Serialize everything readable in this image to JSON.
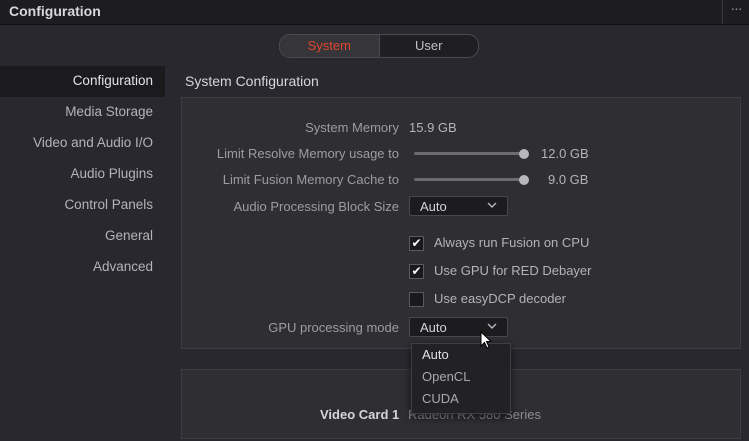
{
  "window": {
    "title": "Configuration",
    "more_glyph": "···"
  },
  "tabs": {
    "system": "System",
    "user": "User"
  },
  "sidebar": {
    "items": [
      {
        "label": "Configuration"
      },
      {
        "label": "Media Storage"
      },
      {
        "label": "Video and Audio I/O"
      },
      {
        "label": "Audio Plugins"
      },
      {
        "label": "Control Panels"
      },
      {
        "label": "General"
      },
      {
        "label": "Advanced"
      }
    ],
    "active": "Configuration"
  },
  "section": {
    "title": "System Configuration"
  },
  "config": {
    "system_memory_label": "System Memory",
    "system_memory_value": "15.9 GB",
    "limit_resolve_label": "Limit Resolve Memory usage to",
    "limit_resolve_value": "12.0 GB",
    "limit_resolve_fraction": 1.0,
    "limit_fusion_label": "Limit Fusion Memory Cache to",
    "limit_fusion_value": "9.0 GB",
    "limit_fusion_fraction": 1.0,
    "audio_block_label": "Audio Processing Block Size",
    "audio_block_value": "Auto",
    "fusion_cpu_label": "Always run Fusion on CPU",
    "fusion_cpu_checked": true,
    "gpu_red_label": "Use GPU for RED Debayer",
    "gpu_red_checked": true,
    "easydcp_label": "Use easyDCP decoder",
    "easydcp_checked": false,
    "gpu_mode_label": "GPU processing mode",
    "gpu_mode_value": "Auto"
  },
  "gpu_mode_menu": {
    "options": [
      "Auto",
      "OpenCL",
      "CUDA"
    ],
    "highlighted": "Auto"
  },
  "video_card": {
    "label": "Video Card 1",
    "value_partial": "Radeon RX 580 Series"
  },
  "colors": {
    "accent": "#e0452d",
    "background": "#28282e",
    "panel": "#2e2e33"
  },
  "icons": {
    "checkmark": "✔",
    "chevron": "chevron-down-icon",
    "cursor": "arrow-cursor"
  }
}
